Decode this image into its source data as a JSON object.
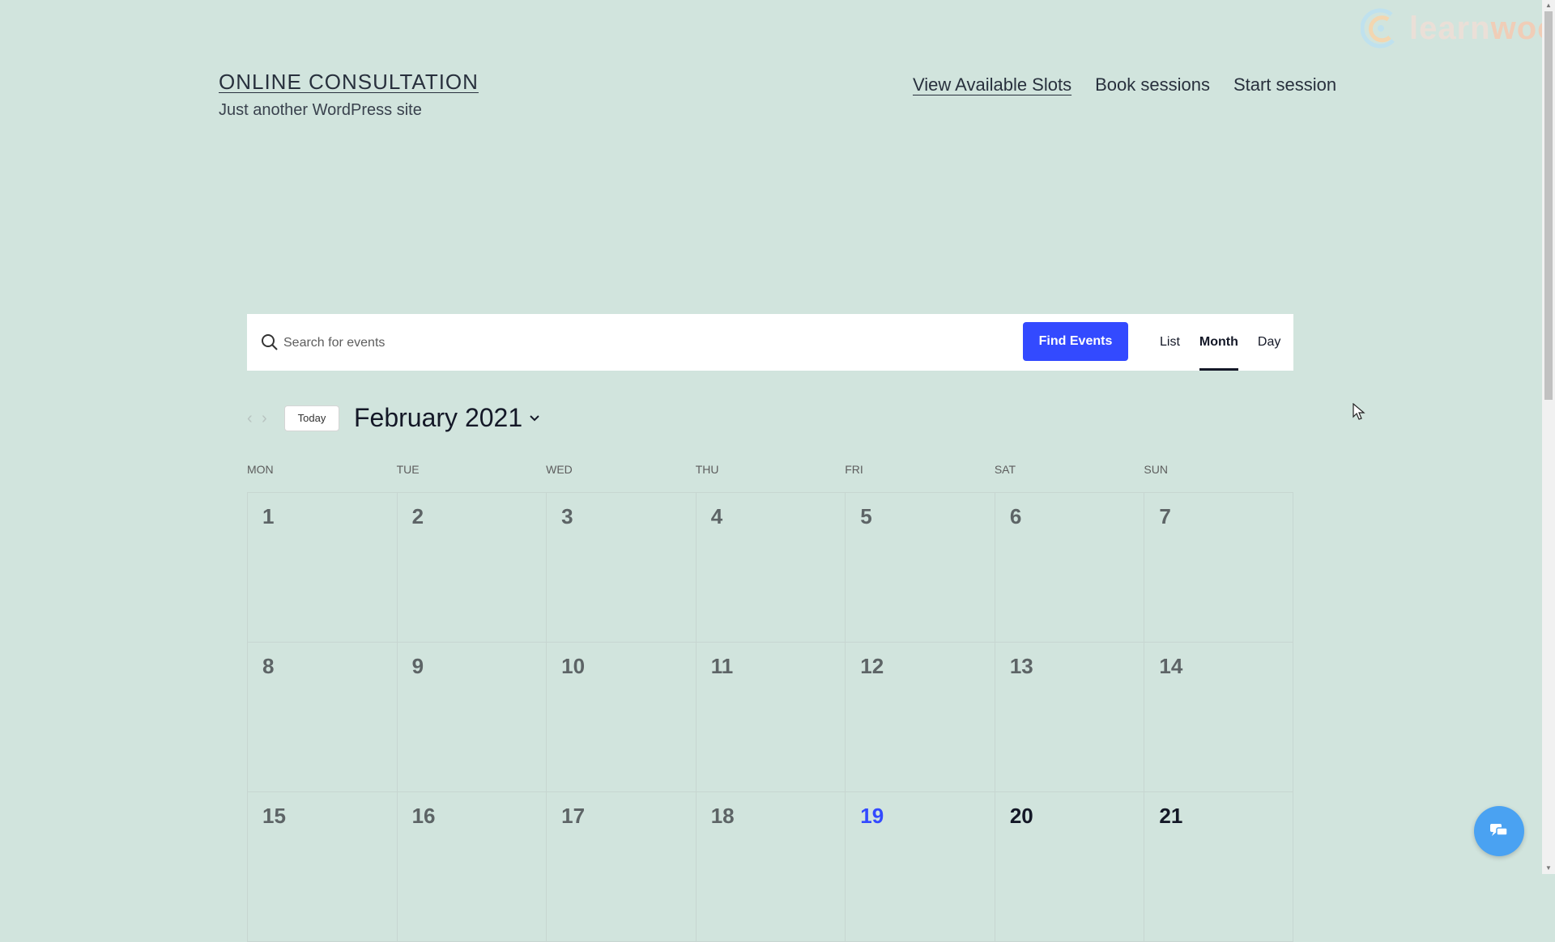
{
  "site": {
    "title": "ONLINE CONSULTATION",
    "tagline": "Just another WordPress site"
  },
  "nav": {
    "items": [
      "View Available Slots",
      "Book sessions",
      "Start session"
    ]
  },
  "logo": {
    "text_a": "learn",
    "text_b": "woo"
  },
  "search": {
    "placeholder": "Search for events",
    "button": "Find Events"
  },
  "views": [
    "List",
    "Month",
    "Day"
  ],
  "toolbar": {
    "today": "Today",
    "month": "February 2021"
  },
  "calendar": {
    "days_of_week": [
      "MON",
      "TUE",
      "WED",
      "THU",
      "FRI",
      "SAT",
      "SUN"
    ],
    "weeks": [
      [
        "1",
        "2",
        "3",
        "4",
        "5",
        "6",
        "7"
      ],
      [
        "8",
        "9",
        "10",
        "11",
        "12",
        "13",
        "14"
      ],
      [
        "15",
        "16",
        "17",
        "18",
        "19",
        "20",
        "21"
      ]
    ],
    "today": "19"
  },
  "colors": {
    "background": "#d1e4dd",
    "accent": "#334aff",
    "chat": "#4aa2f2"
  }
}
